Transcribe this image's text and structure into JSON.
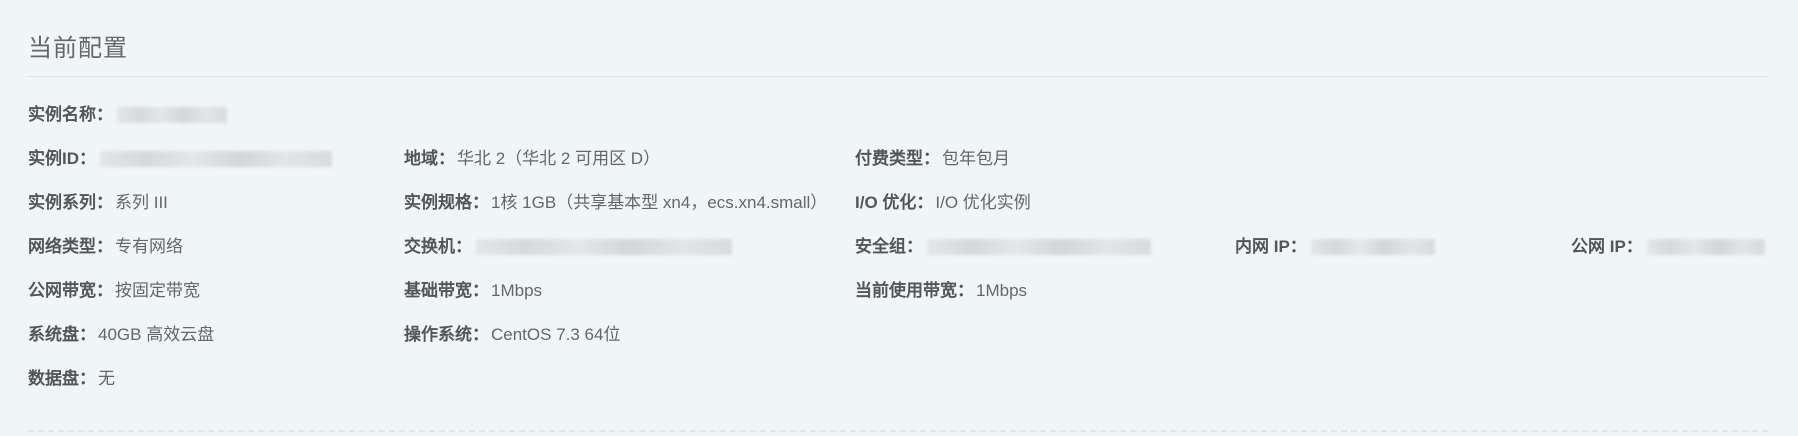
{
  "section": {
    "title": "当前配置"
  },
  "fields": {
    "instance_name": {
      "label": "实例名称",
      "value": ""
    },
    "instance_id": {
      "label": "实例ID",
      "value": ""
    },
    "region": {
      "label": "地域",
      "value": "华北 2（华北 2 可用区 D）"
    },
    "billing_type": {
      "label": "付费类型",
      "value": "包年包月"
    },
    "instance_series": {
      "label": "实例系列",
      "value": "系列 III"
    },
    "instance_spec": {
      "label": "实例规格",
      "value": "1核 1GB（共享基本型 xn4，ecs.xn4.small）"
    },
    "io_optimized": {
      "label": "I/O 优化",
      "value": "I/O 优化实例"
    },
    "network_type": {
      "label": "网络类型",
      "value": "专有网络"
    },
    "vswitch": {
      "label": "交换机",
      "value": ""
    },
    "security_group": {
      "label": "安全组",
      "value": ""
    },
    "private_ip": {
      "label": "内网 IP",
      "value": ""
    },
    "public_ip": {
      "label": "公网 IP",
      "value": ""
    },
    "public_bandwidth": {
      "label": "公网带宽",
      "value": "按固定带宽"
    },
    "base_bandwidth": {
      "label": "基础带宽",
      "value": "1Mbps"
    },
    "current_bandwidth": {
      "label": "当前使用带宽 ",
      "value": "1Mbps"
    },
    "system_disk": {
      "label": "系统盘",
      "value": "40GB 高效云盘"
    },
    "os": {
      "label": "操作系统",
      "value": "CentOS 7.3 64位"
    },
    "data_disk": {
      "label": "数据盘",
      "value": "无"
    }
  },
  "separator": "："
}
